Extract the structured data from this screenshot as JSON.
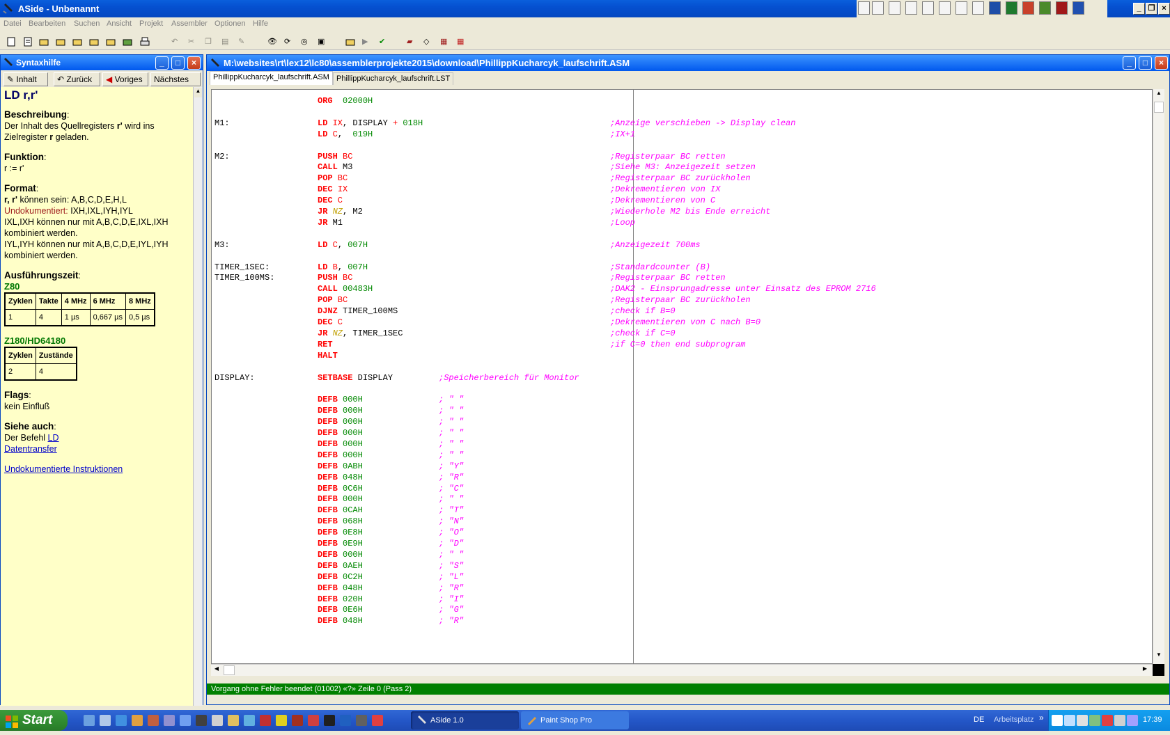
{
  "app": {
    "title": "ASide - Unbenannt"
  },
  "menu": [
    "Datei",
    "Bearbeiten",
    "Suchen",
    "Ansicht",
    "Projekt",
    "Assembler",
    "Optionen",
    "Hilfe"
  ],
  "help": {
    "title": "Syntaxhilfe",
    "nav": {
      "contents": "Inhalt",
      "back": "Zurück",
      "prev": "Voriges",
      "next": "Nächstes"
    },
    "heading": "LD r,r'",
    "desc_title": "Beschreibung",
    "desc_1": "Der Inhalt des Quellregisters ",
    "desc_bold1": "r'",
    "desc_2": " wird ins",
    "desc_3": "Zielregister ",
    "desc_bold2": "r",
    "desc_4": " geladen.",
    "func_title": "Funktion",
    "func_text": "r := r'",
    "format_title": "Format",
    "format_bold": "r, r'",
    "format_text": " können sein: A,B,C,D,E,H,L",
    "undoc_label": "Undokumentiert:",
    "undoc_text": " IXH,IXL,IYH,IYL",
    "ix_text": "IXL,IXH können nur mit A,B,C,D,E,IXL,IXH",
    "ix_text2": "kombiniert werden.",
    "iy_text": "IYL,IYH können nur mit A,B,C,D,E,IYL,IYH",
    "iy_text2": "kombiniert werden.",
    "exec_title": "Ausführungszeit",
    "z80_label": "Z80",
    "z80_headers": [
      "Zyklen",
      "Takte",
      "4 MHz",
      "6 MHz",
      "8 MHz"
    ],
    "z80_row": [
      "1",
      "4",
      "1 µs",
      "0,667 µs",
      "0,5 µs"
    ],
    "z180_label": "Z180/HD64180",
    "z180_headers": [
      "Zyklen",
      "Zustände"
    ],
    "z180_row": [
      "2",
      "4"
    ],
    "flags_title": "Flags",
    "flags_text": "kein Einfluß",
    "see_title": "Siehe auch",
    "see_text": "Der Befehl ",
    "see_link1": "LD",
    "see_link2": "Datentransfer",
    "undoc_link": "Undokumentierte Instruktionen"
  },
  "editor": {
    "title": "M:\\websites\\rt\\lex12\\lc80\\assemblerprojekte2015\\download\\PhillippKucharcyk_laufschrift.ASM",
    "tabs": [
      "PhillippKucharcyk_laufschrift.ASM",
      "PhillippKucharcyk_laufschrift.LST"
    ],
    "status": "Vorgang ohne Fehler beendet (01002) «?» Zeile 0 (Pass 2)"
  },
  "code_lines": [
    {
      "label": "",
      "parts": [
        [
          "kw",
          "ORG"
        ],
        [
          "",
          "  "
        ],
        [
          "nm",
          "02000H"
        ]
      ],
      "comment": ""
    },
    {
      "label": "M1:",
      "parts": [
        [
          "kw",
          "LD"
        ],
        [
          "",
          ""
        ],
        [
          "rg",
          " IX"
        ],
        [
          "",
          ", DISPLAY "
        ],
        [
          "op",
          "+"
        ],
        [
          "nm",
          " 018H"
        ]
      ],
      "comment": ";Anzeige verschieben -> Display clean"
    },
    {
      "label": "",
      "parts": [
        [
          "kw",
          "LD"
        ],
        [
          "rg",
          " C"
        ],
        [
          "",
          ",  "
        ],
        [
          "nm",
          "019H"
        ]
      ],
      "comment": ";IX+1"
    },
    {
      "label": "M2:",
      "parts": [
        [
          "kw",
          "PUSH"
        ],
        [
          "rg",
          " BC"
        ]
      ],
      "comment": ";Registerpaar BC retten"
    },
    {
      "label": "",
      "parts": [
        [
          "kw",
          "CALL"
        ],
        [
          "",
          " M3"
        ]
      ],
      "comment": ";Siehe M3: Anzeigezeit setzen"
    },
    {
      "label": "",
      "parts": [
        [
          "kw",
          "POP"
        ],
        [
          "rg",
          " BC"
        ]
      ],
      "comment": ";Registerpaar BC zurückholen"
    },
    {
      "label": "",
      "parts": [
        [
          "kw",
          "DEC"
        ],
        [
          "rg",
          " IX"
        ]
      ],
      "comment": ";Dekrementieren von IX"
    },
    {
      "label": "",
      "parts": [
        [
          "kw",
          "DEC"
        ],
        [
          "rg",
          " C"
        ]
      ],
      "comment": ";Dekrementieren von C"
    },
    {
      "label": "",
      "parts": [
        [
          "kw",
          "JR"
        ],
        [
          "cz",
          " NZ"
        ],
        [
          "",
          ", M2"
        ]
      ],
      "comment": ";Wiederhole M2 bis Ende erreicht"
    },
    {
      "label": "",
      "parts": [
        [
          "kw",
          "JR"
        ],
        [
          "",
          " M1"
        ]
      ],
      "comment": ";Loop"
    },
    {
      "label": "M3:",
      "parts": [
        [
          "kw",
          "LD"
        ],
        [
          "rg",
          " C"
        ],
        [
          "",
          ", "
        ],
        [
          "nm",
          "007H"
        ]
      ],
      "comment": ";Anzeigezeit 700ms"
    },
    {
      "label": "TIMER_1SEC:",
      "parts": [
        [
          "kw",
          "LD"
        ],
        [
          "rg",
          " B"
        ],
        [
          "",
          ", "
        ],
        [
          "nm",
          "007H"
        ]
      ],
      "comment": ";Standardcounter (B)"
    },
    {
      "label": "TIMER_100MS:",
      "parts": [
        [
          "kw",
          "PUSH"
        ],
        [
          "rg",
          " BC"
        ]
      ],
      "comment": ";Registerpaar BC retten"
    },
    {
      "label": "",
      "parts": [
        [
          "kw",
          "CALL"
        ],
        [
          "nm",
          " 00483H"
        ]
      ],
      "comment": ";DAK2 - Einsprungadresse unter Einsatz des EPROM 2716"
    },
    {
      "label": "",
      "parts": [
        [
          "kw",
          "POP"
        ],
        [
          "rg",
          " BC"
        ]
      ],
      "comment": ";Registerpaar BC zurückholen"
    },
    {
      "label": "",
      "parts": [
        [
          "kw",
          "DJNZ"
        ],
        [
          "",
          " TIMER_100MS"
        ]
      ],
      "comment": ";check if B=0"
    },
    {
      "label": "",
      "parts": [
        [
          "kw",
          "DEC"
        ],
        [
          "rg",
          " C"
        ]
      ],
      "comment": ";Dekrementieren von C nach B=0"
    },
    {
      "label": "",
      "parts": [
        [
          "kw",
          "JR"
        ],
        [
          "cz",
          " NZ"
        ],
        [
          "",
          ", TIMER_1SEC"
        ]
      ],
      "comment": ";check if C=0"
    },
    {
      "label": "",
      "parts": [
        [
          "kw",
          "RET"
        ]
      ],
      "comment": ";if C=0 then end subprogram"
    },
    {
      "label": "",
      "parts": [
        [
          "kw",
          "HALT"
        ]
      ],
      "comment": ""
    },
    {
      "label": "DISPLAY:",
      "parts": [
        [
          "kw",
          "SETBASE"
        ],
        [
          "",
          " DISPLAY"
        ]
      ],
      "inline": ";Speicherbereich für Monitor",
      "comment": ""
    }
  ],
  "defb": [
    [
      "000H",
      "; \" \""
    ],
    [
      "000H",
      "; \" \""
    ],
    [
      "000H",
      "; \" \""
    ],
    [
      "000H",
      "; \" \""
    ],
    [
      "000H",
      "; \" \""
    ],
    [
      "000H",
      "; \" \""
    ],
    [
      "0ABH",
      "; \"Y\""
    ],
    [
      "048H",
      "; \"R\""
    ],
    [
      "0C6H",
      "; \"C\""
    ],
    [
      "000H",
      "; \" \""
    ],
    [
      "0CAH",
      "; \"T\""
    ],
    [
      "068H",
      "; \"N\""
    ],
    [
      "0E8H",
      "; \"O\""
    ],
    [
      "0E9H",
      "; \"D\""
    ],
    [
      "000H",
      "; \" \""
    ],
    [
      "0AEH",
      "; \"S\""
    ],
    [
      "0C2H",
      "; \"L\""
    ],
    [
      "048H",
      "; \"R\""
    ],
    [
      "020H",
      "; \"I\""
    ],
    [
      "0E6H",
      "; \"G\""
    ],
    [
      "048H",
      "; \"R\""
    ]
  ],
  "taskbar": {
    "start": "Start",
    "tasks": [
      "ASide 1.0",
      "Paint Shop Pro"
    ],
    "lang": "DE",
    "place": "Arbeitsplatz",
    "time": "17:39"
  }
}
